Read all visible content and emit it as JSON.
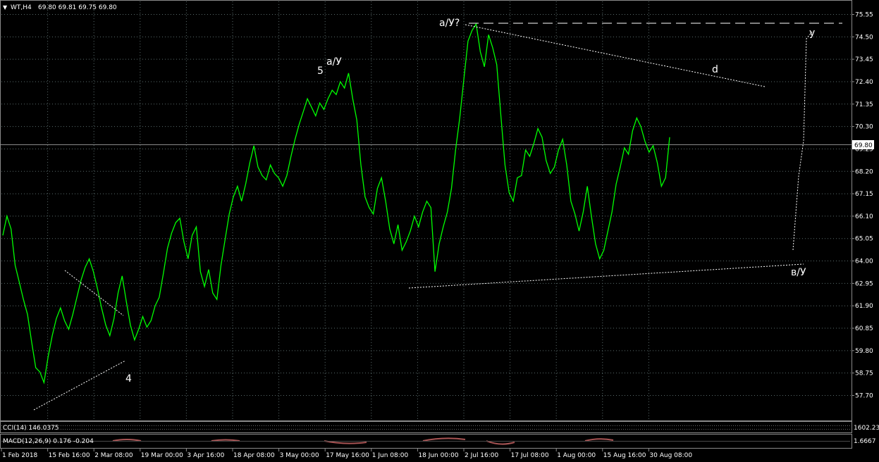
{
  "header": {
    "symbol_text": "WT,H4",
    "ohlc_text": "69.80 69.81 69.75 69.80"
  },
  "price_tag": "69.80",
  "indicators": {
    "cci_label": "CCI(14) 146.0375",
    "macd_label": "MACD(12,26,9) 0.176 -0.204",
    "cci_axis_label": "1602.2338",
    "macd_axis_label": "1.6667"
  },
  "wave_labels": {
    "w4": "4",
    "w5": "5",
    "a1": "a/У",
    "a2": "a/У?",
    "d": "d",
    "b": "в/У",
    "y": "у"
  },
  "colors": {
    "background": "#000000",
    "price_line": "#00ff00",
    "grid": "#5a6b6b",
    "text": "#ffffff",
    "annotation": "#ffffff"
  },
  "chart_data": {
    "type": "line",
    "title": "",
    "ylim": [
      57.7,
      75.9
    ],
    "y_ticks": [
      "75.55",
      "74.50",
      "73.45",
      "72.40",
      "71.35",
      "70.30",
      "69.25",
      "68.20",
      "67.15",
      "66.10",
      "65.05",
      "64.00",
      "62.95",
      "61.90",
      "60.85",
      "59.80",
      "58.75",
      "57.70"
    ],
    "x_ticks": [
      "1 Feb 2018",
      "15 Feb 16:00",
      "2 Mar 08:00",
      "19 Mar 00:00",
      "3 Apr 16:00",
      "18 Apr 08:00",
      "3 May 00:00",
      "17 May 16:00",
      "1 Jun 08:00",
      "18 Jun 00:00",
      "2 Jul 16:00",
      "17 Jul 08:00",
      "1 Aug 00:00",
      "15 Aug 16:00",
      "30 Aug 08:00"
    ],
    "grid": true,
    "series": [
      {
        "values": [
          65.2,
          66.1,
          65.5,
          63.8,
          63.0,
          62.2,
          61.5,
          60.2,
          59.0,
          58.8,
          58.3,
          59.5,
          60.5,
          61.3,
          61.8,
          61.2,
          60.8,
          61.5,
          62.3,
          63.1,
          63.7,
          64.1,
          63.5,
          62.7,
          61.8,
          61.0,
          60.5,
          61.3,
          62.5,
          63.3,
          62.1,
          61.0,
          60.3,
          60.8,
          61.4,
          60.9,
          61.2,
          61.9,
          62.3,
          63.4,
          64.6,
          65.3,
          65.8,
          66.0,
          64.9,
          64.1,
          65.2,
          65.6,
          63.5,
          62.8,
          63.6,
          62.5,
          62.2,
          63.8,
          65.0,
          66.2,
          67.0,
          67.5,
          66.8,
          67.6,
          68.6,
          69.4,
          68.4,
          68.0,
          67.8,
          68.5,
          68.1,
          67.9,
          67.5,
          68.0,
          68.9,
          69.7,
          70.4,
          71.0,
          71.6,
          71.2,
          70.8,
          71.4,
          71.1,
          71.6,
          72.0,
          71.8,
          72.4,
          72.1,
          72.8,
          71.6,
          70.6,
          68.5,
          67.0,
          66.5,
          66.2,
          67.4,
          67.9,
          66.8,
          65.5,
          64.8,
          65.7,
          64.5,
          64.9,
          65.4,
          66.1,
          65.6,
          66.3,
          66.8,
          66.5,
          63.5,
          64.8,
          65.6,
          66.3,
          67.4,
          69.2,
          70.7,
          72.5,
          74.3,
          74.8,
          75.1,
          73.8,
          73.1,
          74.6,
          74.0,
          73.2,
          70.8,
          68.5,
          67.2,
          66.8,
          67.9,
          68.0,
          69.2,
          68.9,
          69.5,
          70.2,
          69.8,
          68.7,
          68.1,
          68.4,
          69.2,
          69.7,
          68.5,
          66.8,
          66.2,
          65.4,
          66.3,
          67.5,
          66.1,
          64.8,
          64.1,
          64.5,
          65.4,
          66.3,
          67.6,
          68.4,
          69.3,
          69.0,
          70.1,
          70.7,
          70.3,
          69.6,
          69.1,
          69.4,
          68.6,
          67.5,
          67.9,
          69.8
        ]
      }
    ]
  }
}
